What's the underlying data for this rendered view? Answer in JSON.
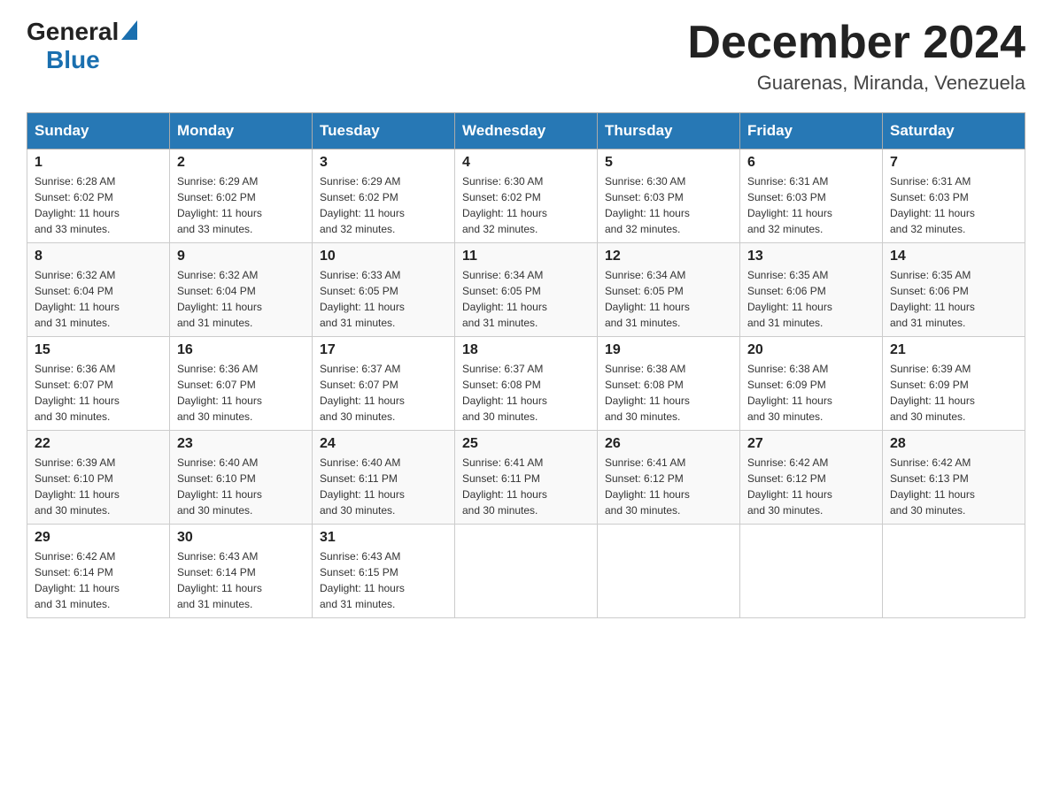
{
  "header": {
    "logo_general": "General",
    "logo_blue": "Blue",
    "month_title": "December 2024",
    "subtitle": "Guarenas, Miranda, Venezuela"
  },
  "days_of_week": [
    "Sunday",
    "Monday",
    "Tuesday",
    "Wednesday",
    "Thursday",
    "Friday",
    "Saturday"
  ],
  "weeks": [
    [
      {
        "day": "1",
        "sunrise": "6:28 AM",
        "sunset": "6:02 PM",
        "daylight": "11 hours and 33 minutes."
      },
      {
        "day": "2",
        "sunrise": "6:29 AM",
        "sunset": "6:02 PM",
        "daylight": "11 hours and 33 minutes."
      },
      {
        "day": "3",
        "sunrise": "6:29 AM",
        "sunset": "6:02 PM",
        "daylight": "11 hours and 32 minutes."
      },
      {
        "day": "4",
        "sunrise": "6:30 AM",
        "sunset": "6:02 PM",
        "daylight": "11 hours and 32 minutes."
      },
      {
        "day": "5",
        "sunrise": "6:30 AM",
        "sunset": "6:03 PM",
        "daylight": "11 hours and 32 minutes."
      },
      {
        "day": "6",
        "sunrise": "6:31 AM",
        "sunset": "6:03 PM",
        "daylight": "11 hours and 32 minutes."
      },
      {
        "day": "7",
        "sunrise": "6:31 AM",
        "sunset": "6:03 PM",
        "daylight": "11 hours and 32 minutes."
      }
    ],
    [
      {
        "day": "8",
        "sunrise": "6:32 AM",
        "sunset": "6:04 PM",
        "daylight": "11 hours and 31 minutes."
      },
      {
        "day": "9",
        "sunrise": "6:32 AM",
        "sunset": "6:04 PM",
        "daylight": "11 hours and 31 minutes."
      },
      {
        "day": "10",
        "sunrise": "6:33 AM",
        "sunset": "6:05 PM",
        "daylight": "11 hours and 31 minutes."
      },
      {
        "day": "11",
        "sunrise": "6:34 AM",
        "sunset": "6:05 PM",
        "daylight": "11 hours and 31 minutes."
      },
      {
        "day": "12",
        "sunrise": "6:34 AM",
        "sunset": "6:05 PM",
        "daylight": "11 hours and 31 minutes."
      },
      {
        "day": "13",
        "sunrise": "6:35 AM",
        "sunset": "6:06 PM",
        "daylight": "11 hours and 31 minutes."
      },
      {
        "day": "14",
        "sunrise": "6:35 AM",
        "sunset": "6:06 PM",
        "daylight": "11 hours and 31 minutes."
      }
    ],
    [
      {
        "day": "15",
        "sunrise": "6:36 AM",
        "sunset": "6:07 PM",
        "daylight": "11 hours and 30 minutes."
      },
      {
        "day": "16",
        "sunrise": "6:36 AM",
        "sunset": "6:07 PM",
        "daylight": "11 hours and 30 minutes."
      },
      {
        "day": "17",
        "sunrise": "6:37 AM",
        "sunset": "6:07 PM",
        "daylight": "11 hours and 30 minutes."
      },
      {
        "day": "18",
        "sunrise": "6:37 AM",
        "sunset": "6:08 PM",
        "daylight": "11 hours and 30 minutes."
      },
      {
        "day": "19",
        "sunrise": "6:38 AM",
        "sunset": "6:08 PM",
        "daylight": "11 hours and 30 minutes."
      },
      {
        "day": "20",
        "sunrise": "6:38 AM",
        "sunset": "6:09 PM",
        "daylight": "11 hours and 30 minutes."
      },
      {
        "day": "21",
        "sunrise": "6:39 AM",
        "sunset": "6:09 PM",
        "daylight": "11 hours and 30 minutes."
      }
    ],
    [
      {
        "day": "22",
        "sunrise": "6:39 AM",
        "sunset": "6:10 PM",
        "daylight": "11 hours and 30 minutes."
      },
      {
        "day": "23",
        "sunrise": "6:40 AM",
        "sunset": "6:10 PM",
        "daylight": "11 hours and 30 minutes."
      },
      {
        "day": "24",
        "sunrise": "6:40 AM",
        "sunset": "6:11 PM",
        "daylight": "11 hours and 30 minutes."
      },
      {
        "day": "25",
        "sunrise": "6:41 AM",
        "sunset": "6:11 PM",
        "daylight": "11 hours and 30 minutes."
      },
      {
        "day": "26",
        "sunrise": "6:41 AM",
        "sunset": "6:12 PM",
        "daylight": "11 hours and 30 minutes."
      },
      {
        "day": "27",
        "sunrise": "6:42 AM",
        "sunset": "6:12 PM",
        "daylight": "11 hours and 30 minutes."
      },
      {
        "day": "28",
        "sunrise": "6:42 AM",
        "sunset": "6:13 PM",
        "daylight": "11 hours and 30 minutes."
      }
    ],
    [
      {
        "day": "29",
        "sunrise": "6:42 AM",
        "sunset": "6:14 PM",
        "daylight": "11 hours and 31 minutes."
      },
      {
        "day": "30",
        "sunrise": "6:43 AM",
        "sunset": "6:14 PM",
        "daylight": "11 hours and 31 minutes."
      },
      {
        "day": "31",
        "sunrise": "6:43 AM",
        "sunset": "6:15 PM",
        "daylight": "11 hours and 31 minutes."
      },
      null,
      null,
      null,
      null
    ]
  ],
  "labels": {
    "sunrise": "Sunrise:",
    "sunset": "Sunset:",
    "daylight": "Daylight:"
  },
  "colors": {
    "header_bg": "#2778b5",
    "header_text": "#ffffff",
    "border": "#aaaaaa"
  }
}
